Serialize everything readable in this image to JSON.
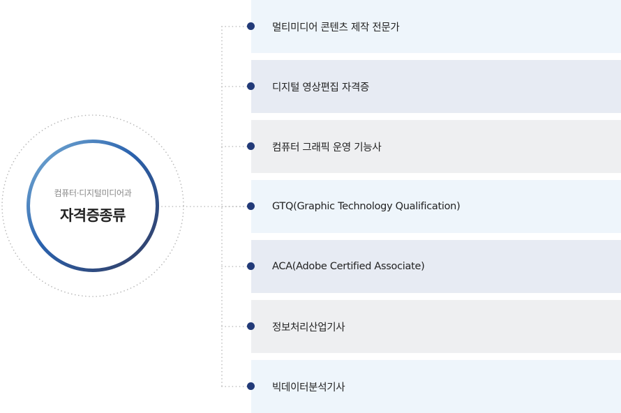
{
  "center": {
    "subtitle": "컴퓨터·디지털미디어과",
    "title": "자격증종류"
  },
  "items": [
    {
      "label": "멀티미디어 콘텐츠 제작 전문가",
      "bg": "#eef5fb"
    },
    {
      "label": "디지털 영상편집 자격증",
      "bg": "#e7ebf3"
    },
    {
      "label": "컴퓨터 그래픽 운영 기능사",
      "bg": "#eeeff1"
    },
    {
      "label": "GTQ(Graphic Technology Qualification)",
      "bg": "#eef5fb"
    },
    {
      "label": "ACA(Adobe Certified Associate)",
      "bg": "#e7ebf3"
    },
    {
      "label": "정보처리산업기사",
      "bg": "#eeeff1"
    },
    {
      "label": "빅데이터분석기사",
      "bg": "#eef5fb"
    }
  ],
  "colors": {
    "dot": "#223a78",
    "dotted_line": "#b8b8b8",
    "ring_start": "#7fb4d8",
    "ring_mid": "#2a62ae",
    "ring_end": "#343a5c"
  }
}
